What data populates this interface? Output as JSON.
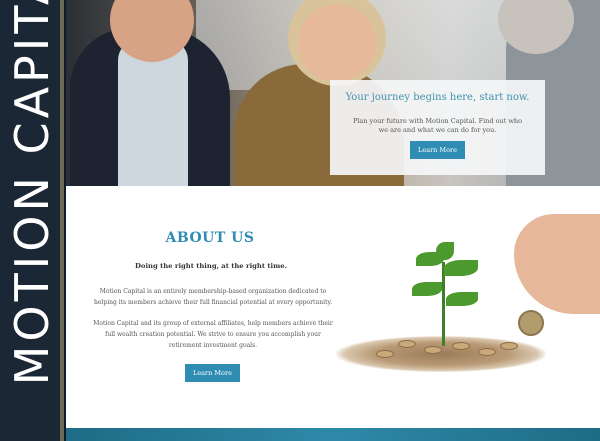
{
  "brand": {
    "name": "MOTION CAPITAL"
  },
  "hero": {
    "headline": "Your journey begins here, start now.",
    "description": "Plan your future with Motion Capital. Find out who we are and what we can do for you.",
    "button_label": "Learn More"
  },
  "about": {
    "title": "ABOUT US",
    "tagline": "Doing the right thing, at the right time.",
    "paragraph1": "Motion Capital is an entirely membership-based organization dedicated to helping its members achieve their full financial potential at every opportunity.",
    "paragraph2": "Motion Capital and its group of external affiliates, help members achieve their full wealth creation potential. We strive to ensure you accomplish your retirement investment goals.",
    "button_label": "Learn More"
  },
  "colors": {
    "accent": "#2f8cb2",
    "brand_strip": "#1c2735",
    "bottom_band": "#2e89a8"
  }
}
